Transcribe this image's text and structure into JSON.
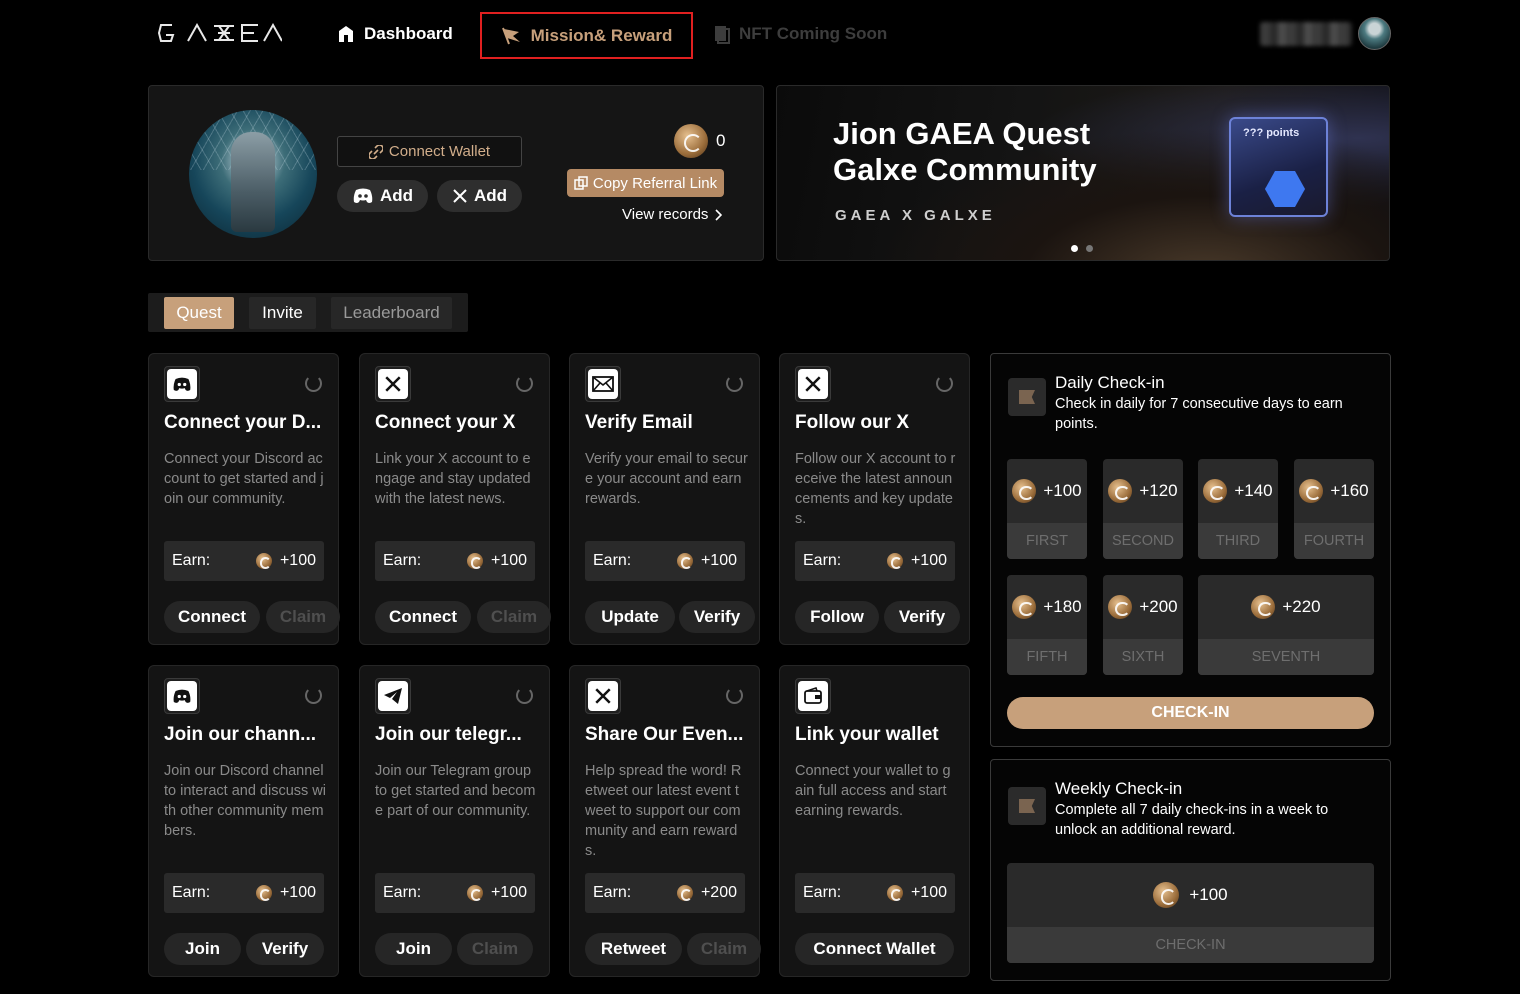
{
  "nav": {
    "logo": "GAEA",
    "dashboard": "Dashboard",
    "mission": "Mission& Reward",
    "nft": "NFT Coming Soon",
    "highlight_color": "#e02020"
  },
  "profile": {
    "connect_wallet": "Connect Wallet",
    "discord_add": "Add",
    "x_add": "Add",
    "points": "0",
    "copy_referral": "Copy Referral Link",
    "view_records": "View records"
  },
  "banner": {
    "title_line1": "Jion GAEA Quest",
    "title_line2": "Galxe Community",
    "partners": "GAEA X GALXE",
    "card_label": "??? points",
    "slide_count": 2,
    "active_slide": 1
  },
  "tabs": [
    {
      "label": "Quest",
      "active": true
    },
    {
      "label": "Invite",
      "active": false
    },
    {
      "label": "Leaderboard",
      "active": false
    }
  ],
  "earn_label": "Earn:",
  "quests": [
    {
      "icon": "discord-icon",
      "title": "Connect your D...",
      "desc": "Connect your Discord account to get started and join our community.",
      "earn": "+100",
      "btn1": "Connect",
      "btn2": "Claim",
      "btn2_dim": true
    },
    {
      "icon": "x-icon",
      "title": "Connect your X",
      "desc": "Link your X account to engage and stay updated with the latest news.",
      "earn": "+100",
      "btn1": "Connect",
      "btn2": "Claim",
      "btn2_dim": true
    },
    {
      "icon": "mail-icon",
      "title": "Verify Email",
      "desc": "Verify your email to secure your account and earn rewards.",
      "earn": "+100",
      "btn1": "Update",
      "btn2": "Verify",
      "btn2_dim": false
    },
    {
      "icon": "x-icon",
      "title": "Follow our X",
      "desc": "Follow our X account to receive the latest announcements and key updates.",
      "earn": "+100",
      "btn1": "Follow",
      "btn2": "Verify",
      "btn2_dim": false
    },
    {
      "icon": "discord-icon",
      "title": "Join our chann...",
      "desc": "Join our Discord channel to interact and discuss with other community members.",
      "earn": "+100",
      "btn1": "Join",
      "btn2": "Verify",
      "btn2_dim": false
    },
    {
      "icon": "telegram-icon",
      "title": "Join our telegr...",
      "desc": "Join our Telegram group to get started and become part of our community.",
      "earn": "+100",
      "btn1": "Join",
      "btn2": "Claim",
      "btn2_dim": true
    },
    {
      "icon": "x-icon",
      "title": "Share Our Even...",
      "desc": "Help spread the word! Retweet our latest event tweet to support our community and earn rewards.",
      "earn": "+200",
      "btn1": "Retweet",
      "btn2": "Claim",
      "btn2_dim": true
    },
    {
      "icon": "wallet-icon",
      "title": "Link your wallet",
      "desc": "Connect your wallet to gain full access and start earning rewards.",
      "earn": "+100",
      "btn1": "Connect Wallet",
      "btn2": null,
      "btn2_dim": false
    }
  ],
  "daily": {
    "title": "Daily Check-in",
    "desc": "Check in daily for 7 consecutive days to earn points.",
    "days": [
      {
        "points": "+100",
        "label": "FIRST"
      },
      {
        "points": "+120",
        "label": "SECOND"
      },
      {
        "points": "+140",
        "label": "THIRD"
      },
      {
        "points": "+160",
        "label": "FOURTH"
      },
      {
        "points": "+180",
        "label": "FIFTH"
      },
      {
        "points": "+200",
        "label": "SIXTH"
      },
      {
        "points": "+220",
        "label": "SEVENTH"
      }
    ],
    "button": "CHECK-IN",
    "accent": "#c7a07b"
  },
  "weekly": {
    "title": "Weekly Check-in",
    "desc": "Complete all 7 daily check-ins in a week to unlock an additional reward.",
    "points": "+100",
    "button": "CHECK-IN"
  }
}
